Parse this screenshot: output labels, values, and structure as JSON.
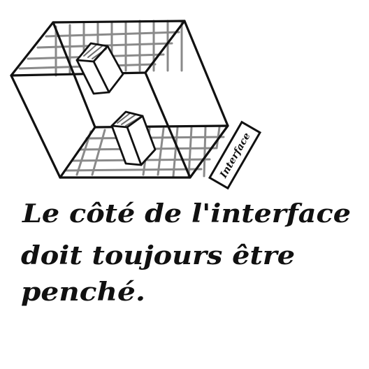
{
  "diagram": {
    "interface_label": "Interface",
    "caption": {
      "line1": "Le côté de l'interface",
      "line2": "doit toujours être",
      "line3": "penché."
    },
    "colors": {
      "ink": "#111111",
      "grid": "#8a8a8a",
      "background": "#ffffff"
    }
  }
}
